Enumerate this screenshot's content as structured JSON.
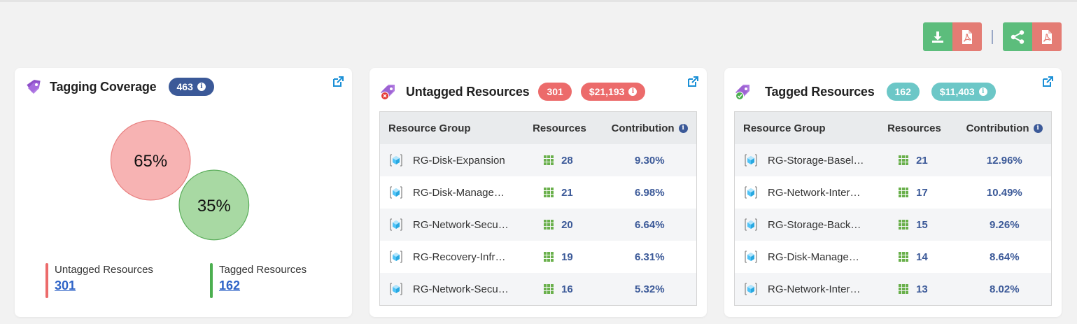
{
  "toolbar": {
    "buttons": [
      "download-icon",
      "pdf-icon",
      "share-icon",
      "pdf-icon"
    ],
    "colors": {
      "green": "#5cbd7c",
      "red": "#e47c74"
    }
  },
  "coverage": {
    "title": "Tagging Coverage",
    "total_badge": "463",
    "untagged_pct": "65%",
    "tagged_pct": "35%",
    "untagged_label": "Untagged Resources",
    "untagged_count": "301",
    "tagged_label": "Tagged Resources",
    "tagged_count": "162",
    "colors": {
      "untagged": "#f7b3b3",
      "tagged": "#a8d9a3"
    }
  },
  "untagged": {
    "title": "Untagged Resources",
    "count_badge": "301",
    "cost_badge": "$21,193",
    "columns": [
      "Resource Group",
      "Resources",
      "Contribution"
    ],
    "rows": [
      {
        "name": "RG-Disk-Expansion",
        "resources": "28",
        "contribution": "9.30%"
      },
      {
        "name": "RG-Disk-Manage…",
        "resources": "21",
        "contribution": "6.98%"
      },
      {
        "name": "RG-Network-Secu…",
        "resources": "20",
        "contribution": "6.64%"
      },
      {
        "name": "RG-Recovery-Infr…",
        "resources": "19",
        "contribution": "6.31%"
      },
      {
        "name": "RG-Network-Secu…",
        "resources": "16",
        "contribution": "5.32%"
      }
    ]
  },
  "tagged": {
    "title": "Tagged Resources",
    "count_badge": "162",
    "cost_badge": "$11,403",
    "columns": [
      "Resource Group",
      "Resources",
      "Contribution"
    ],
    "rows": [
      {
        "name": "RG-Storage-Basel…",
        "resources": "21",
        "contribution": "12.96%"
      },
      {
        "name": "RG-Network-Inter…",
        "resources": "17",
        "contribution": "10.49%"
      },
      {
        "name": "RG-Storage-Back…",
        "resources": "15",
        "contribution": "9.26%"
      },
      {
        "name": "RG-Disk-Manage…",
        "resources": "14",
        "contribution": "8.64%"
      },
      {
        "name": "RG-Network-Inter…",
        "resources": "13",
        "contribution": "8.02%"
      }
    ]
  }
}
